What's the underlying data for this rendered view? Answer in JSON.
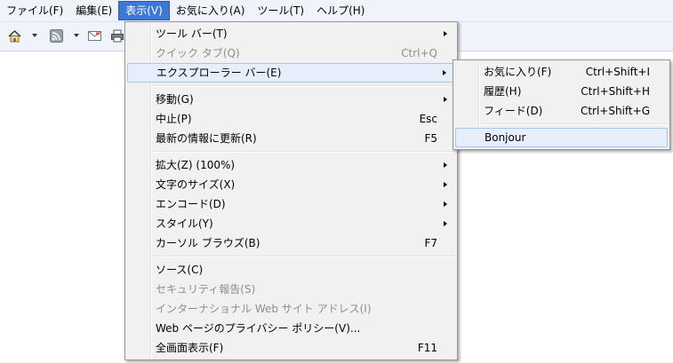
{
  "menubar": {
    "items": [
      {
        "label": "ファイル(F)",
        "active": false
      },
      {
        "label": "編集(E)",
        "active": false
      },
      {
        "label": "表示(V)",
        "active": true
      },
      {
        "label": "お気に入り(A)",
        "active": false
      },
      {
        "label": "ツール(T)",
        "active": false
      },
      {
        "label": "ヘルプ(H)",
        "active": false
      }
    ]
  },
  "toolbar": {
    "icons": [
      "home-icon",
      "rss-feed-icon",
      "mail-icon",
      "print-icon"
    ]
  },
  "view_menu": {
    "groups": [
      [
        {
          "label": "ツール バー(T)",
          "submenu": true,
          "disabled": false
        },
        {
          "label": "クイック タブ(Q)",
          "shortcut": "Ctrl+Q",
          "disabled": true
        },
        {
          "label": "エクスプローラー バー(E)",
          "submenu": true,
          "disabled": false,
          "highlight": true
        }
      ],
      [
        {
          "label": "移動(G)",
          "submenu": true,
          "disabled": false
        },
        {
          "label": "中止(P)",
          "shortcut": "Esc",
          "disabled": false
        },
        {
          "label": "最新の情報に更新(R)",
          "shortcut": "F5",
          "disabled": false
        }
      ],
      [
        {
          "label": "拡大(Z) (100%)",
          "submenu": true,
          "disabled": false
        },
        {
          "label": "文字のサイズ(X)",
          "submenu": true,
          "disabled": false
        },
        {
          "label": "エンコード(D)",
          "submenu": true,
          "disabled": false
        },
        {
          "label": "スタイル(Y)",
          "submenu": true,
          "disabled": false
        },
        {
          "label": "カーソル ブラウズ(B)",
          "shortcut": "F7",
          "disabled": false
        }
      ],
      [
        {
          "label": "ソース(C)",
          "disabled": false
        },
        {
          "label": "セキュリティ報告(S)",
          "disabled": true
        },
        {
          "label": "インターナショナル Web サイト アドレス(I)",
          "disabled": true
        },
        {
          "label": "Web ページのプライバシー ポリシー(V)...",
          "disabled": false
        },
        {
          "label": "全画面表示(F)",
          "shortcut": "F11",
          "disabled": false
        }
      ]
    ]
  },
  "explorer_bar_submenu": {
    "groups": [
      [
        {
          "label": "お気に入り(F)",
          "shortcut": "Ctrl+Shift+I"
        },
        {
          "label": "履歴(H)",
          "shortcut": "Ctrl+Shift+H"
        },
        {
          "label": "フィード(D)",
          "shortcut": "Ctrl+Shift+G"
        }
      ],
      [
        {
          "label": "Bonjour",
          "highlight": true
        }
      ]
    ]
  }
}
